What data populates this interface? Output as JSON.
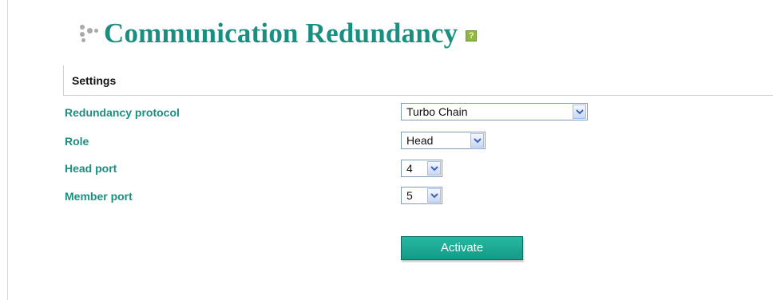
{
  "page": {
    "title": "Communication Redundancy",
    "help_icon_label": "?"
  },
  "settings": {
    "section_title": "Settings",
    "fields": {
      "protocol": {
        "label": "Redundancy protocol",
        "value": "Turbo Chain"
      },
      "role": {
        "label": "Role",
        "value": "Head"
      },
      "head_port": {
        "label": "Head port",
        "value": "4"
      },
      "member_port": {
        "label": "Member port",
        "value": "5"
      }
    }
  },
  "actions": {
    "activate_label": "Activate"
  },
  "icons": [
    "dots-icon",
    "help-icon",
    "chevron-down-icon"
  ],
  "colors": {
    "title": "#1a8f80",
    "label": "#1a8f80",
    "button": "#1aa892",
    "button_text": "#ffffff"
  }
}
